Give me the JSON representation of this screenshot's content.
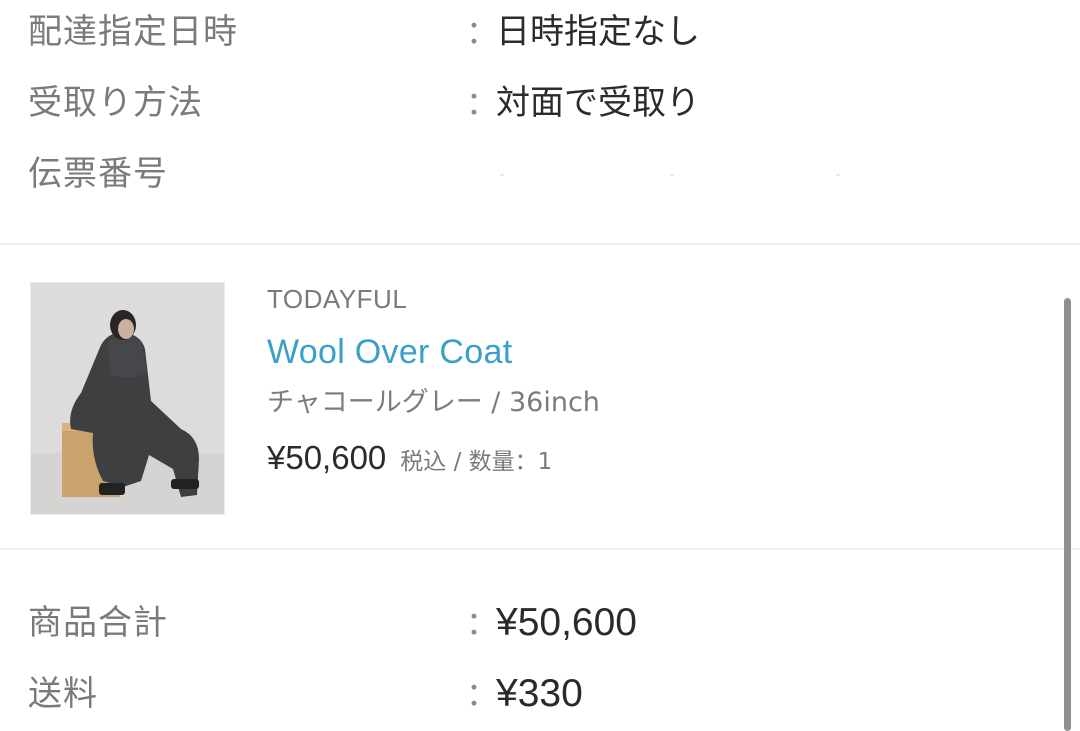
{
  "delivery": {
    "datetime_label": "配達指定日時",
    "datetime_value": "日時指定なし",
    "method_label": "受取り方法",
    "method_value": "対面で受取り",
    "tracking_label": "伝票番号",
    "colon": "："
  },
  "product": {
    "brand": "TODAYFUL",
    "name": "Wool Over Coat",
    "variant": "チャコールグレー / 36inch",
    "price": "¥50,600",
    "price_note": "税込 / 数量：1",
    "image_icon": "product-photo"
  },
  "summary": {
    "subtotal_label": "商品合計",
    "subtotal_value": "¥50,600",
    "shipping_label": "送料",
    "shipping_value": "¥330"
  }
}
